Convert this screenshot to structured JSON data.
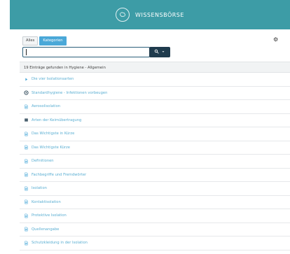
{
  "header": {
    "title": "WISSENSBÖRSE"
  },
  "toolbar": {
    "tab_all": "Alles",
    "tab_categories": "Kategorien"
  },
  "search": {
    "value": ""
  },
  "results": {
    "summary": "19 Einträge gefunden in Hygiene - Allgemein",
    "items": [
      {
        "label": "Die vier Isolationsarten",
        "icon": "caret-right-icon"
      },
      {
        "label": "Standardhygiene - Infektionen vorbeugen",
        "icon": "target-icon"
      },
      {
        "label": "Aerosolisolation",
        "icon": "document-icon"
      },
      {
        "label": "Arten der Keimübertragung",
        "icon": "stack-icon"
      },
      {
        "label": "Das Wichtigste in Kürze",
        "icon": "document-icon"
      },
      {
        "label": "Das Wichtigste Kürze",
        "icon": "document-icon"
      },
      {
        "label": "Definitionen",
        "icon": "document-icon"
      },
      {
        "label": "Fachbegriffe und Fremdwörter",
        "icon": "document-icon"
      },
      {
        "label": "Isolation",
        "icon": "document-icon"
      },
      {
        "label": "Kontaktisolation",
        "icon": "document-icon"
      },
      {
        "label": "Protektive Isolation",
        "icon": "document-icon"
      },
      {
        "label": "Quellenangabe",
        "icon": "document-icon"
      },
      {
        "label": "Schutzkleidung in der Isolation",
        "icon": "document-icon"
      }
    ]
  },
  "colors": {
    "header_bg": "#3d9ca6",
    "accent": "#4aa8d8",
    "search_btn_bg": "#1f3b4d",
    "link_text": "#5aaed2"
  }
}
